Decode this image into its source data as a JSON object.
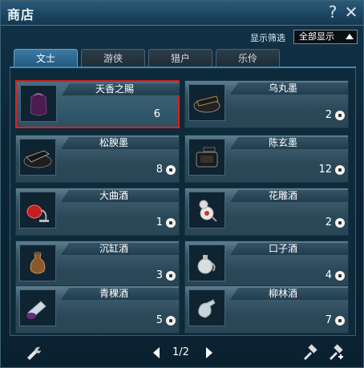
{
  "window": {
    "title": "商店"
  },
  "filter": {
    "label": "显示筛选",
    "value": "全部显示"
  },
  "tabs": [
    {
      "label": "文士",
      "active": true
    },
    {
      "label": "游侠",
      "active": false
    },
    {
      "label": "猎户",
      "active": false
    },
    {
      "label": "乐伶",
      "active": false
    }
  ],
  "items": [
    {
      "name": "天香之賜",
      "count": "6",
      "icon": "purple-bag-icon",
      "selected": true,
      "currency": false
    },
    {
      "name": "乌丸墨",
      "count": "2",
      "icon": "ink-stick-icon",
      "selected": false,
      "currency": true
    },
    {
      "name": "松腴墨",
      "count": "8",
      "icon": "ink-stick-icon",
      "selected": false,
      "currency": true
    },
    {
      "name": "陈玄墨",
      "count": "12",
      "icon": "ink-stone-icon",
      "selected": false,
      "currency": true
    },
    {
      "name": "大曲酒",
      "count": "1",
      "icon": "wine-gourd-icon",
      "selected": false,
      "currency": true
    },
    {
      "name": "花雕酒",
      "count": "2",
      "icon": "wine-gourd-icon",
      "selected": false,
      "currency": true
    },
    {
      "name": "沉缸酒",
      "count": "3",
      "icon": "wine-jar-icon",
      "selected": false,
      "currency": true
    },
    {
      "name": "口子酒",
      "count": "4",
      "icon": "wine-jar-icon",
      "selected": false,
      "currency": true
    },
    {
      "name": "青稞酒",
      "count": "5",
      "icon": "wine-bottle-icon",
      "selected": false,
      "currency": true
    },
    {
      "name": "柳林酒",
      "count": "7",
      "icon": "wine-bottle-icon",
      "selected": false,
      "currency": true
    }
  ],
  "pager": {
    "text": "1/2"
  },
  "colors": {
    "accent": "#3f8ab8",
    "selected_border": "#e11c1c"
  }
}
